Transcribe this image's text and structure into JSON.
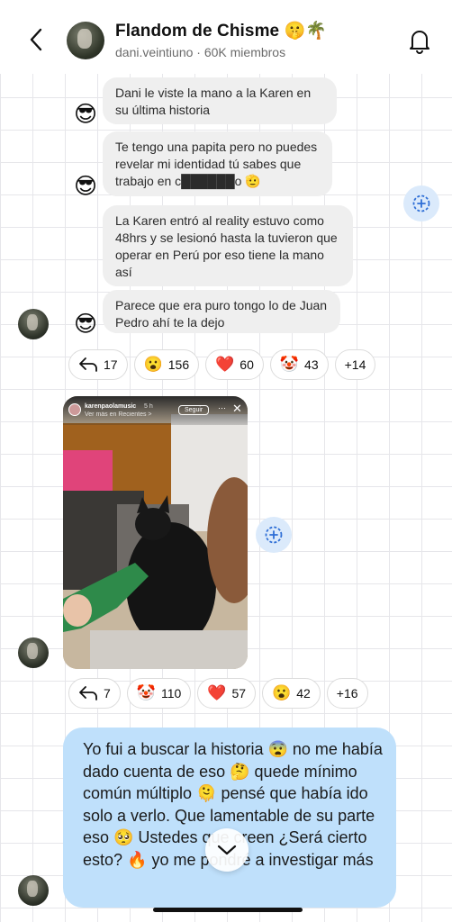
{
  "header": {
    "title": "Flandom de Chisme 🤫🌴",
    "subtitle": "dani.veintiuno · 60K miembros"
  },
  "messages": [
    {
      "text": "Dani le viste la mano a la Karen en su última historia",
      "avatar_emoji": "😎"
    },
    {
      "text": "Te tengo una papita pero no puedes revelar mi identidad tú sabes que trabajo en c██████o 🫡",
      "avatar_emoji": "😎"
    },
    {
      "text": "La Karen entró al reality estuvo como 48hrs y se lesionó hasta la tuvieron que operar en Perú por eso tiene la mano así"
    },
    {
      "text": "Parece que era puro tongo lo de Juan Pedro ahí te la dejo",
      "avatar_emoji": "😎"
    }
  ],
  "reactions_1": [
    {
      "icon": "reply-icon",
      "emoji": "↰",
      "count": "17"
    },
    {
      "emoji": "😮",
      "count": "156"
    },
    {
      "emoji": "❤️",
      "count": "60"
    },
    {
      "emoji": "🤡",
      "count": "43"
    },
    {
      "emoji": "",
      "count": "+14"
    }
  ],
  "story": {
    "username": "karenpaolamusic",
    "time": "5 h",
    "sub": "Ver más en Recientes >",
    "follow": "Seguir"
  },
  "reactions_2": [
    {
      "icon": "reply-icon",
      "emoji": "↰",
      "count": "7"
    },
    {
      "emoji": "🤡",
      "count": "110"
    },
    {
      "emoji": "❤️",
      "count": "57"
    },
    {
      "emoji": "😮",
      "count": "42"
    },
    {
      "emoji": "",
      "count": "+16"
    }
  ],
  "reply": {
    "text": "Yo fui a buscar la historia 😨 no me había dado cuenta de eso 🤔 quede mínimo común múltiplo 🫠 pensé que había ido solo a verlo. Que lamentable de su parte eso 🥺 Ustedes que creen ¿Será cierto esto? 🔥 yo me pondré a investigar más"
  },
  "colors": {
    "bubble_gray": "#efefef",
    "bubble_blue": "#bfe0fb",
    "share_bg": "#dbeafb",
    "share_icon": "#2f6fd6"
  }
}
